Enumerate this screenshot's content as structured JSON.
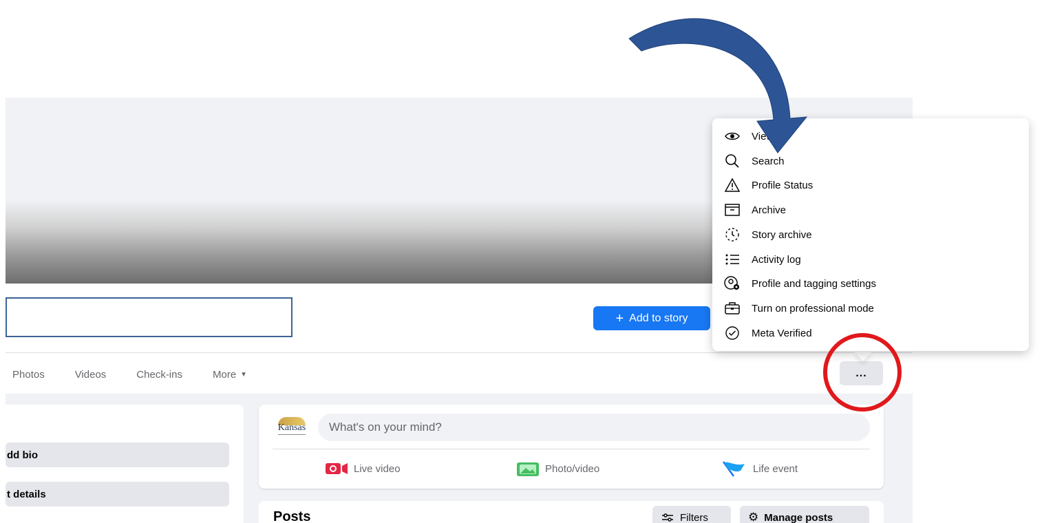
{
  "header": {
    "add_to_story_label": "Add to story",
    "more_options_label": "..."
  },
  "tabs": [
    {
      "label": "Photos"
    },
    {
      "label": "Videos"
    },
    {
      "label": "Check-ins"
    },
    {
      "label": "More"
    }
  ],
  "intro": {
    "add_bio_label": "dd bio",
    "edit_details_label": "t details"
  },
  "composer": {
    "avatar_text": "Kansas",
    "placeholder": "What's on your mind?",
    "actions": [
      {
        "label": "Live video",
        "icon": "live-video-icon",
        "color": "#e42645"
      },
      {
        "label": "Photo/video",
        "icon": "photo-video-icon",
        "color": "#45bd62"
      },
      {
        "label": "Life event",
        "icon": "life-event-flag-icon",
        "color": "#1877f2"
      }
    ]
  },
  "posts": {
    "title": "Posts",
    "filters_label": "Filters",
    "manage_label": "Manage posts"
  },
  "dropdown_menu": {
    "items": [
      {
        "label": "View As",
        "icon": "eye-icon"
      },
      {
        "label": "Search",
        "icon": "search-icon"
      },
      {
        "label": "Profile Status",
        "icon": "warning-triangle-icon"
      },
      {
        "label": "Archive",
        "icon": "archive-box-icon"
      },
      {
        "label": "Story archive",
        "icon": "story-archive-clock-icon"
      },
      {
        "label": "Activity log",
        "icon": "list-icon"
      },
      {
        "label": "Profile and tagging settings",
        "icon": "profile-gear-icon"
      },
      {
        "label": "Turn on professional mode",
        "icon": "briefcase-icon"
      },
      {
        "label": "Meta Verified",
        "icon": "verified-check-icon"
      }
    ]
  },
  "colors": {
    "primary": "#1877f2",
    "annotation_circle": "#e0191c",
    "annotation_arrow": "#2d5596"
  }
}
